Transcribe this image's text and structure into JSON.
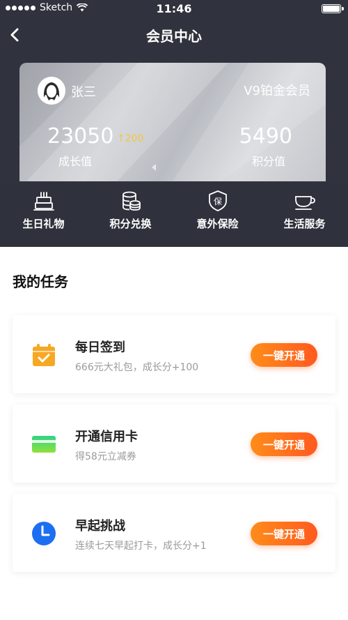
{
  "status_bar": {
    "carrier": "Sketch",
    "time": "11:46"
  },
  "nav": {
    "title": "会员中心"
  },
  "member_card": {
    "username": "张三",
    "level": "V9铂金会员",
    "growth_value": "23050",
    "growth_delta": "↑200",
    "growth_label": "成长值",
    "points_value": "5490",
    "points_label": "积分值"
  },
  "quick_actions": [
    {
      "label": "生日礼物",
      "icon": "birthday-cake-icon"
    },
    {
      "label": "积分兑换",
      "icon": "coins-stack-icon"
    },
    {
      "label": "意外保险",
      "icon": "insurance-shield-icon"
    },
    {
      "label": "生活服务",
      "icon": "coffee-cup-icon"
    }
  ],
  "tasks_section": {
    "title": "我的任务"
  },
  "tasks": [
    {
      "title": "每日签到",
      "desc": "666元大礼包，成长分+100",
      "button": "一键开通",
      "icon": "calendar-check-icon"
    },
    {
      "title": "开通信用卡",
      "desc": "得58元立减券",
      "button": "一键开通",
      "icon": "credit-card-icon"
    },
    {
      "title": "早起挑战",
      "desc": "连续七天早起打卡，成长分+1",
      "button": "一键开通",
      "icon": "clock-icon"
    }
  ],
  "colors": {
    "header_bg": "#30333d",
    "accent_orange": "#ff6a1f",
    "gold": "#f4c543"
  }
}
